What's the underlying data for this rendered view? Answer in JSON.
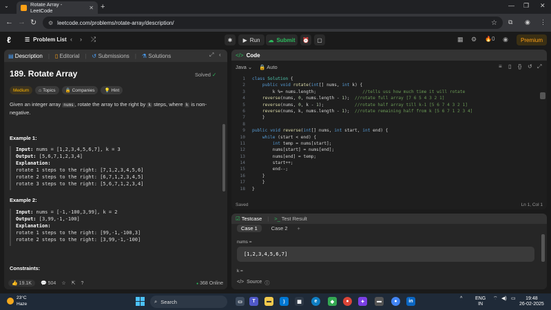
{
  "browser": {
    "tab_title": "Rotate Array - LeetCode",
    "url": "leetcode.com/problems/rotate-array/description/"
  },
  "lc_bar": {
    "problem_list": "Problem List",
    "run": "Run",
    "submit": "Submit",
    "streak": "0",
    "premium": "Premium"
  },
  "left": {
    "tabs": [
      "Description",
      "Editorial",
      "Submissions",
      "Solutions"
    ],
    "title": "189. Rotate Array",
    "solved": "Solved",
    "chips": [
      "Medium",
      "Topics",
      "Companies",
      "Hint"
    ],
    "desc_part1": "Given an integer array ",
    "desc_code1": "nums",
    "desc_part2": ", rotate the array to the right by ",
    "desc_code2": "k",
    "desc_part3": " steps, where ",
    "desc_code3": "k",
    "desc_part4": " is non-negative.",
    "example1": {
      "heading": "Example 1:",
      "input_label": "Input:",
      "input_value": "nums = [1,2,3,4,5,6,7], k = 3",
      "output_label": "Output:",
      "output_value": "[5,6,7,1,2,3,4]",
      "explanation_label": "Explanation:",
      "lines": [
        "rotate 1 steps to the right: [7,1,2,3,4,5,6]",
        "rotate 2 steps to the right: [6,7,1,2,3,4,5]",
        "rotate 3 steps to the right: [5,6,7,1,2,3,4]"
      ]
    },
    "example2": {
      "heading": "Example 2:",
      "input_label": "Input:",
      "input_value": "nums = [-1,-100,3,99], k = 2",
      "output_label": "Output:",
      "output_value": "[3,99,-1,-100]",
      "explanation_label": "Explanation:",
      "lines": [
        "rotate 1 steps to the right: [99,-1,-100,3]",
        "rotate 2 steps to the right: [3,99,-1,-100]"
      ]
    },
    "constraints": "Constraints:",
    "likes": "19.1K",
    "comments": "504",
    "online": "368 Online"
  },
  "code": {
    "header": "Code",
    "language": "Java",
    "auto": "Auto",
    "saved": "Saved",
    "cursor": "Ln 1, Col 1"
  },
  "testcase": {
    "tab1": "Testcase",
    "tab2": "Test Result",
    "case1": "Case 1",
    "case2": "Case 2",
    "nums_label": "nums =",
    "nums_value": "[1,2,3,4,5,6,7]",
    "k_label": "k =",
    "source": "Source"
  },
  "taskbar": {
    "temp": "23°C",
    "weather": "Haze",
    "search": "Search",
    "lang": "ENG",
    "region": "IN",
    "time": "19:48",
    "date": "26-02-2025"
  }
}
